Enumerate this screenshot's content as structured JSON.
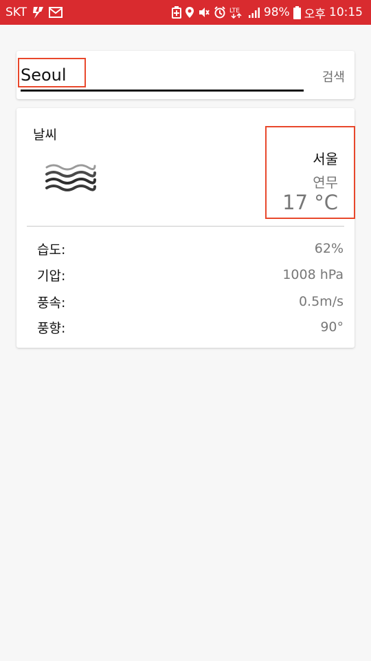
{
  "status_bar": {
    "carrier": "SKT",
    "battery": "98%",
    "ampm": "오후",
    "time": "10:15",
    "network": "LTE",
    "icons": [
      "flash-icon",
      "mail-icon",
      "battery-saver-icon",
      "location-icon",
      "mute-icon",
      "alarm-icon",
      "lte-icon",
      "signal-icon",
      "battery-icon"
    ],
    "background": "#d92b2f"
  },
  "search": {
    "value": "Seoul",
    "button_label": "검색"
  },
  "weather": {
    "title": "날씨",
    "icon": "fog-icon",
    "city": "서울",
    "condition": "연무",
    "temperature": "17 °C",
    "details": [
      {
        "label": "습도:",
        "value": "62%"
      },
      {
        "label": "기압:",
        "value": "1008 hPa"
      },
      {
        "label": "풍속:",
        "value": "0.5m/s"
      },
      {
        "label": "풍향:",
        "value": "90°"
      }
    ]
  },
  "colors": {
    "accent_highlight": "#e8472b",
    "muted_text": "#777777"
  }
}
